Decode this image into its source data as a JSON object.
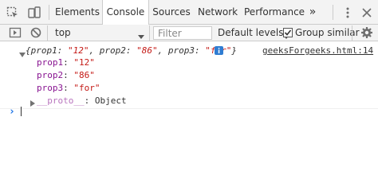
{
  "tabs": {
    "elements": "Elements",
    "console": "Console",
    "sources": "Sources",
    "network": "Network",
    "performance": "Performance",
    "more": "»"
  },
  "toolbar": {
    "context": "top",
    "filter_placeholder": "Filter",
    "levels": "Default levels",
    "group_similar": "Group similar",
    "group_similar_checked": true
  },
  "log": {
    "preview_open": "{",
    "p1_key": "prop1: ",
    "p1_val": "\"12\"",
    "p2_key": ", prop2: ",
    "p2_val": "\"86\"",
    "p3_key": ", prop3: ",
    "p3_val": "\"for\"",
    "preview_close": "}",
    "source": "geeksForgeeks.html:14",
    "properties": [
      {
        "name": "prop1",
        "value": "\"12\""
      },
      {
        "name": "prop2",
        "value": "\"86\""
      },
      {
        "name": "prop3",
        "value": "\"for\""
      }
    ],
    "proto_name": "__proto__",
    "proto_value": ": Object"
  },
  "colors": {
    "accent": "#1a73e8",
    "string": "#c41a16",
    "property": "#881391"
  },
  "icons": [
    "inspect-element-icon",
    "device-toolbar-icon",
    "more-tabs-icon",
    "kebab-menu-icon",
    "close-icon",
    "show-sidebar-icon",
    "clear-console-icon",
    "dropdown-arrow-icon",
    "settings-gear-icon",
    "expand-arrow-icon",
    "info-icon",
    "prompt-chevron-icon"
  ]
}
